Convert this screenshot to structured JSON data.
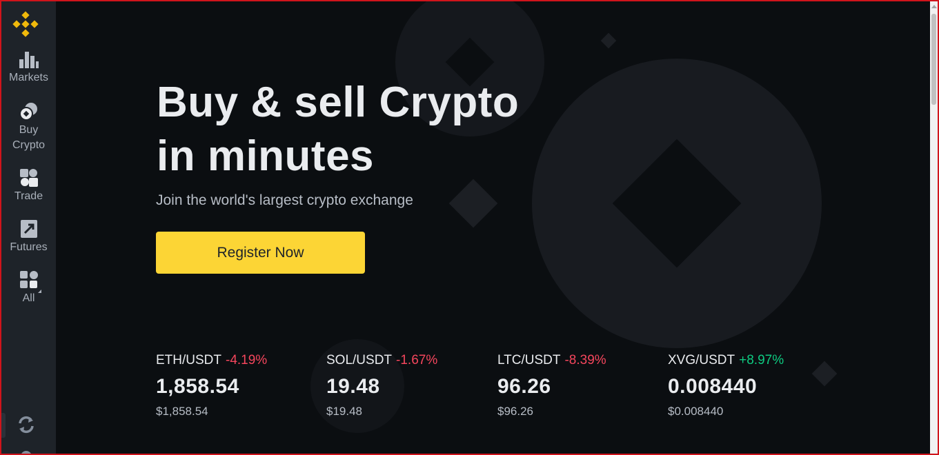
{
  "sidebar": {
    "items": [
      {
        "label_line1": "Markets",
        "label_line2": "",
        "icon": "markets-bar-chart-icon"
      },
      {
        "label_line1": "Buy",
        "label_line2": "Crypto",
        "icon": "buy-crypto-coins-icon"
      },
      {
        "label_line1": "Trade",
        "label_line2": "",
        "icon": "trade-icon"
      },
      {
        "label_line1": "Futures",
        "label_line2": "",
        "icon": "futures-icon"
      },
      {
        "label_line1": "All",
        "label_line2": "",
        "icon": "grid-all-icon"
      }
    ]
  },
  "hero": {
    "title_line1": "Buy & sell Crypto",
    "title_line2": "in minutes",
    "subtitle": "Join the world's largest crypto exchange",
    "cta_label": "Register Now"
  },
  "tickers": [
    {
      "pair": "ETH/USDT",
      "change": "-4.19%",
      "price": "1,858.54",
      "usd": "$1,858.54",
      "direction": "down"
    },
    {
      "pair": "SOL/USDT",
      "change": "-1.67%",
      "price": "19.48",
      "usd": "$19.48",
      "direction": "down"
    },
    {
      "pair": "LTC/USDT",
      "change": "-8.39%",
      "price": "96.26",
      "usd": "$96.26",
      "direction": "down"
    },
    {
      "pair": "XVG/USDT",
      "change": "+8.97%",
      "price": "0.008440",
      "usd": "$0.008440",
      "direction": "up"
    }
  ],
  "colors": {
    "brand_yellow": "#fcd535",
    "background": "#0b0e11",
    "sidebar": "#1e2329",
    "negative": "#f6465d",
    "positive": "#0ecb81"
  }
}
